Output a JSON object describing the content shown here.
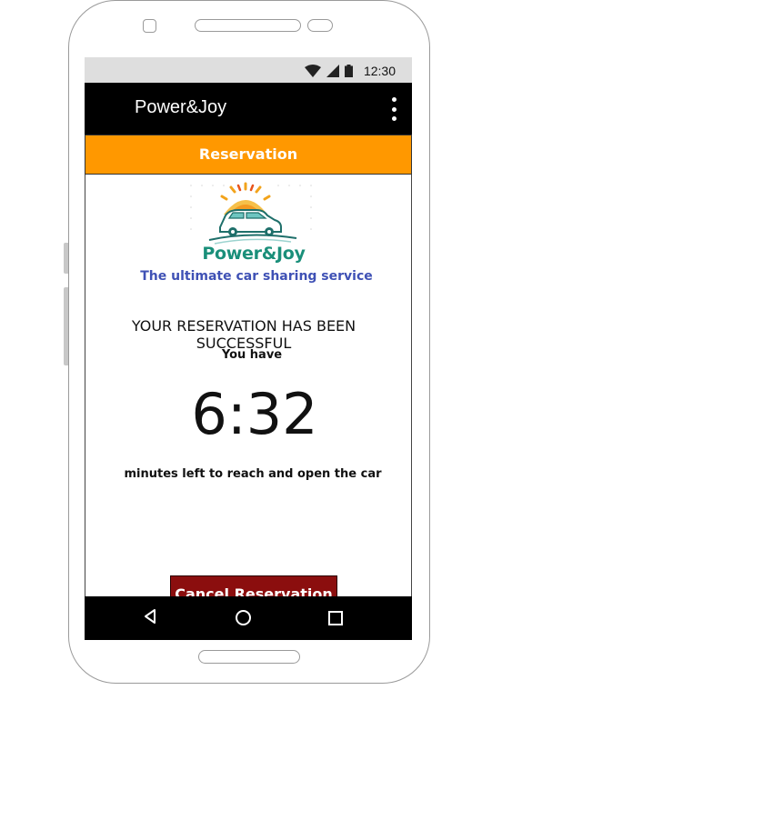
{
  "status_bar": {
    "time": "12:30",
    "icons": [
      "wifi-icon",
      "signal-icon",
      "battery-icon"
    ]
  },
  "app_bar": {
    "title": "Power&Joy",
    "overflow_icon": "more-vert-icon"
  },
  "tab": {
    "label": "Reservation",
    "color": "#ff9800"
  },
  "logo": {
    "text": "Power&Joy",
    "text_color": "#1a8f7a"
  },
  "tagline": "The ultimate car sharing service",
  "reservation": {
    "heading": "YOUR RESERVATION HAS BEEN SUCCESSFUL",
    "prefix": "You have",
    "timer": "6:32",
    "suffix": "minutes left to reach and open the car"
  },
  "cancel_button": {
    "label": "Cancel Reservation",
    "color": "#8b0e0e"
  },
  "nav_bar": {
    "icons": [
      "back-icon",
      "home-icon",
      "recent-apps-icon"
    ]
  }
}
